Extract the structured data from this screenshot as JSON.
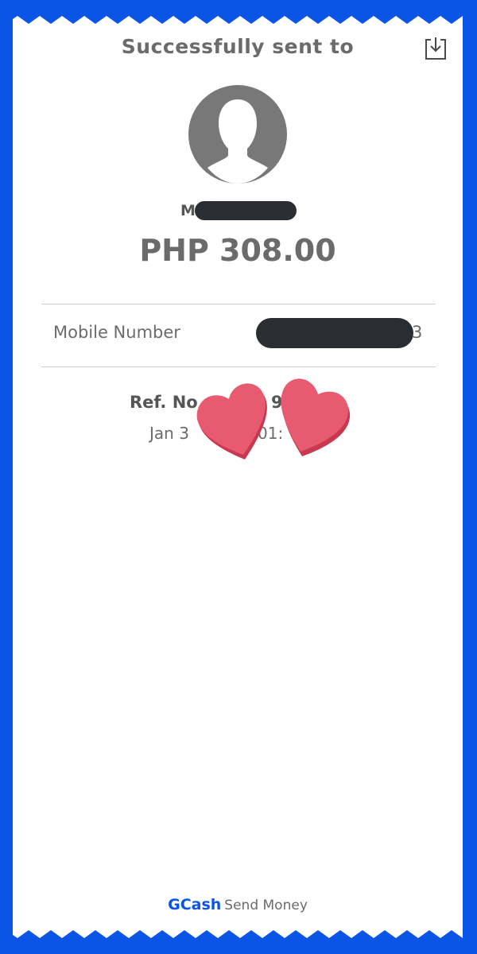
{
  "header": {
    "title": "Successfully sent to",
    "download_icon": "download-icon"
  },
  "recipient": {
    "avatar_icon": "user-avatar-icon",
    "name_visible": "M",
    "amount": "PHP 308.00"
  },
  "details": {
    "mobile_label": "Mobile Number",
    "mobile_visible_suffix": "3"
  },
  "reference": {
    "ref_label_visible": "Ref. No",
    "ref_partial_visible": "98",
    "date_visible_start": "Jan 3",
    "date_visible_mid": "01:"
  },
  "overlay": {
    "hearts_icon": "hearts-sticker-icon"
  },
  "footer": {
    "brand": "GCash",
    "label": "Send Money"
  },
  "colors": {
    "frame_blue": "#0a55e6",
    "heart_red": "#e85a70",
    "text_gray": "#6b6b6b"
  }
}
